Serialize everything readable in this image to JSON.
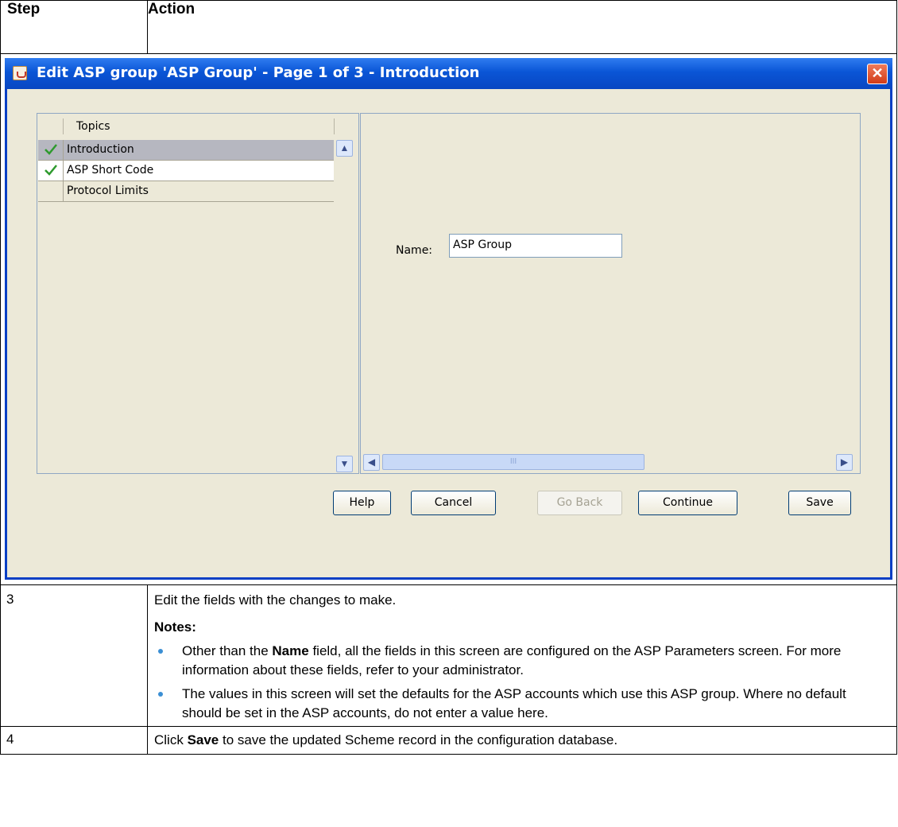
{
  "table": {
    "col_step": "Step",
    "col_action": "Action"
  },
  "dialog": {
    "title": "Edit ASP group 'ASP Group' - Page 1 of 3 - Introduction",
    "close_glyph": "✕",
    "topics_header": "Topics",
    "topics": [
      {
        "label": "Introduction",
        "checked": true,
        "selected": true
      },
      {
        "label": "ASP Short Code",
        "checked": true,
        "selected": false
      },
      {
        "label": "Protocol Limits",
        "checked": false,
        "selected": false
      }
    ],
    "name_label": "Name:",
    "name_value": "ASP Group",
    "scroll_thumb_grip": "III",
    "buttons": {
      "help": "Help",
      "cancel": "Cancel",
      "go_back": "Go Back",
      "continue": "Continue",
      "save": "Save"
    }
  },
  "rows": [
    {
      "step": "3",
      "text": "Edit the fields with the changes to make.",
      "notes_label": "Notes:",
      "bullet1_pre": "Other than the ",
      "bullet1_bold": "Name",
      "bullet1_post": " field, all the fields in this screen are configured on the ASP Parameters screen. For more information about these fields, refer to your administrator.",
      "bullet2": "The values in this screen will set the defaults for the ASP accounts which use this ASP group. Where no default should be set in the ASP accounts, do not enter a value here."
    },
    {
      "step": "4",
      "pre": "Click ",
      "bold": "Save",
      "post": " to save the updated Scheme record in the configuration database."
    }
  ],
  "colors": {
    "titlebar": "#0a55d6",
    "dialog_bg": "#ece9d8",
    "selected_row": "#b6b7c0",
    "check": "#2e9a2e",
    "bullet": "#3b8fd4"
  }
}
